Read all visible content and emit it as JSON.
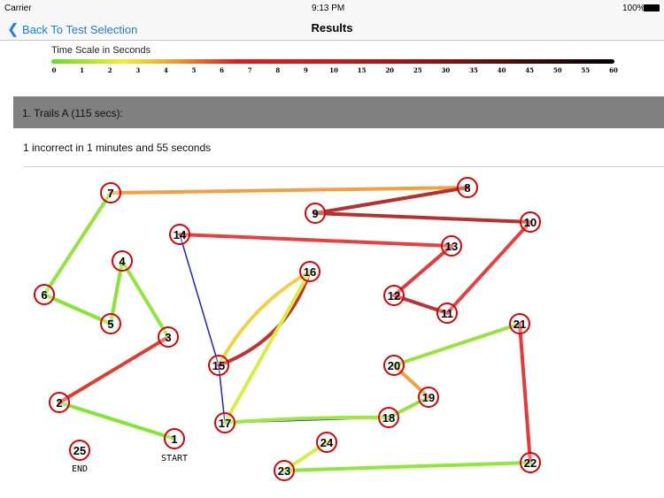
{
  "status": {
    "carrier": "Carrier",
    "time": "9:13 PM",
    "battery": "100%"
  },
  "nav": {
    "back_label": "Back To Test Selection",
    "title": "Results"
  },
  "scale": {
    "label": "Time Scale in Seconds",
    "ticks": [
      "0",
      "1",
      "2",
      "3",
      "4",
      "5",
      "6",
      "7",
      "8",
      "9",
      "10",
      "15",
      "20",
      "25",
      "30",
      "35",
      "40",
      "45",
      "50",
      "55",
      "60"
    ]
  },
  "section": {
    "title": "1.  Trails A (115 secs):"
  },
  "summary": "1 incorrect in 1 minutes and 55 seconds",
  "trail": {
    "nodes": [
      "1",
      "2",
      "3",
      "4",
      "5",
      "6",
      "7",
      "8",
      "9",
      "10",
      "11",
      "12",
      "13",
      "14",
      "15",
      "16",
      "17",
      "18",
      "19",
      "20",
      "21",
      "22",
      "23",
      "24",
      "25"
    ],
    "start_label": "START",
    "end_label": "END",
    "segment_colors": [
      "#7ee830",
      "#e83a30",
      "#8ee836",
      "#86e632",
      "#84e632",
      "#8ee83a",
      "#f4a040",
      "#b8302c",
      "#b8302c",
      "#e84040",
      "#c03030",
      "#e83838",
      "#e84040",
      "#2020d0",
      "#f2d040",
      "#c83030",
      "#2020d0",
      "#d8ee40",
      "#2020d0",
      "#9ee83c",
      "#90e63c",
      "#f4a040",
      "#96e43c",
      "#e83838",
      "#8ee83a",
      "#d8ee40"
    ],
    "error_color": "#2020d0",
    "node_circle_color": "#e00000"
  }
}
